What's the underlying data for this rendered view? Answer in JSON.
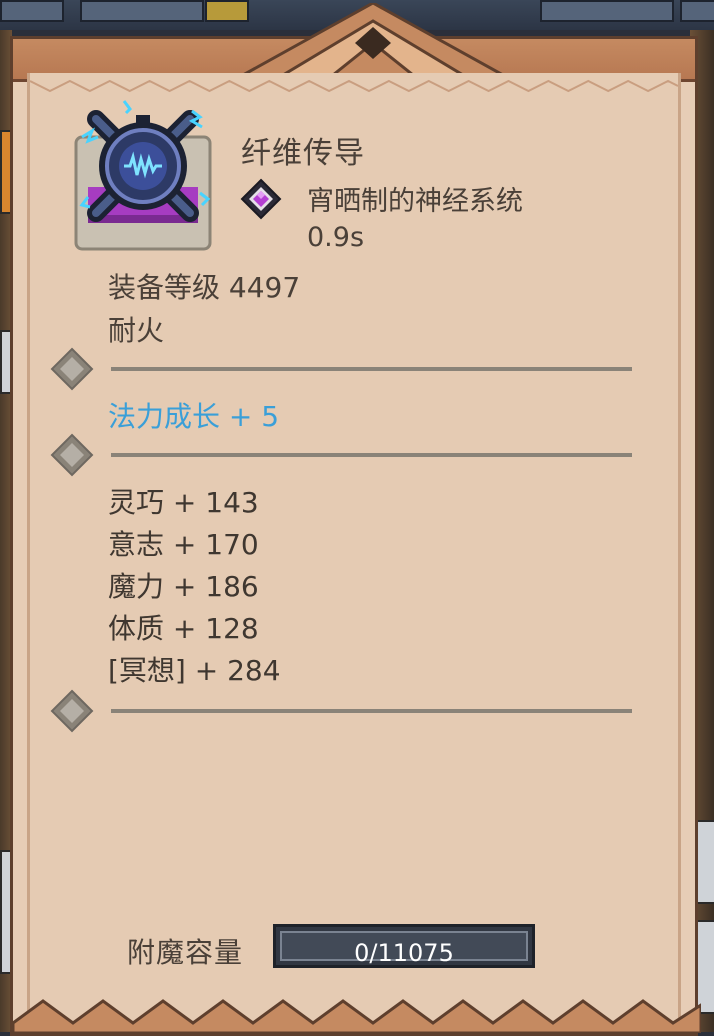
{
  "item": {
    "name": "纤维传导",
    "icon": "mechanical-core-icon",
    "socket": {
      "icon": "purple-gem-icon",
      "label": "宵晒制的神经系统",
      "time": "0.9s"
    },
    "equip_level": "装备等级 4497",
    "affix": "耐火"
  },
  "magic_growth": "法力成长 + 5",
  "stats": [
    {
      "label": "灵巧 + 143"
    },
    {
      "label": "意志 + 170"
    },
    {
      "label": "魔力 + 186"
    },
    {
      "label": "体质 + 128"
    },
    {
      "label": "[冥想] + 284"
    }
  ],
  "enchant": {
    "label": "附魔容量",
    "value": "0/11075",
    "fraction": 0
  },
  "colors": {
    "card_bg": "#e5cbb3",
    "magic_text": "#3a9fd8",
    "divider": "#8a8378",
    "frame": "#b77852"
  }
}
